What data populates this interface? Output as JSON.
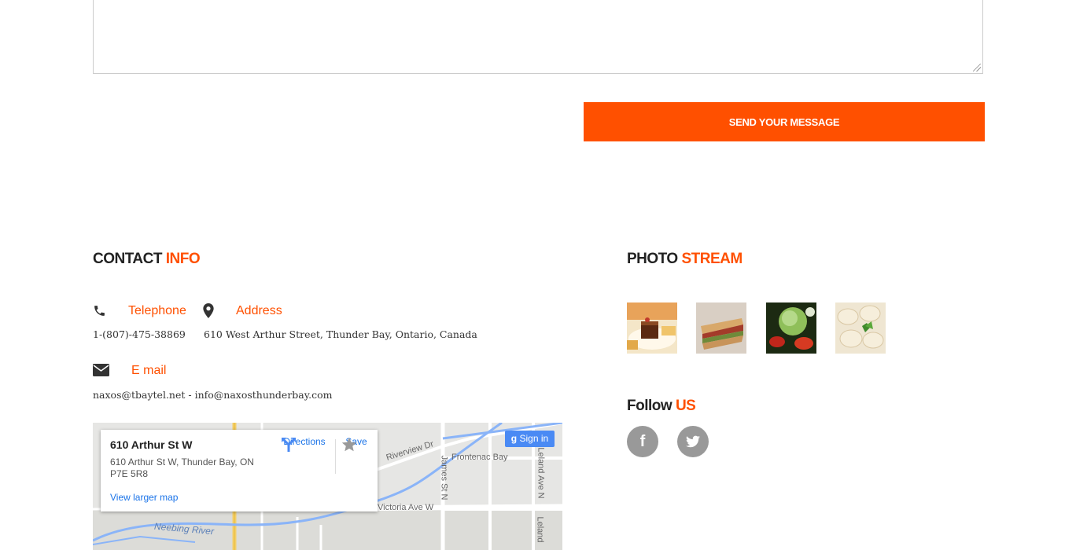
{
  "form": {
    "send_label": "SEND YOUR MESSAGE"
  },
  "contact": {
    "heading_main": "CONTACT",
    "heading_accent": "INFO",
    "telephone_label": "Telephone",
    "telephone_value": "1-(807)-475-38869",
    "address_label": "Address",
    "address_value": "610 West Arthur Street, Thunder Bay, Ontario, Canada",
    "email_label": "E mail",
    "email_value": "naxos@tbaytel.net - info@naxosthunderbay.com"
  },
  "map": {
    "card_title": "610 Arthur St W",
    "card_address": "610 Arthur St W, Thunder Bay, ON P7E 5R8",
    "directions_label": "Directions",
    "save_label": "Save",
    "larger_map_label": "View larger map",
    "signin_label": "Sign in",
    "streets": {
      "riverview": "Riverview Dr",
      "frontenac": "Frontenac Bay",
      "james": "James St N",
      "leland": "Leland Ave N",
      "leland2": "Leland",
      "victoria": "Victoria Ave W",
      "neebing": "Neebing River"
    }
  },
  "photostream": {
    "heading_main": "PHOTO",
    "heading_accent": "STREAM"
  },
  "follow": {
    "heading_main": "Follow",
    "heading_accent": "US",
    "facebook_glyph": "f",
    "twitter_icon": "twitter-icon"
  },
  "colors": {
    "accent": "#ff5000",
    "social": "#999999"
  }
}
